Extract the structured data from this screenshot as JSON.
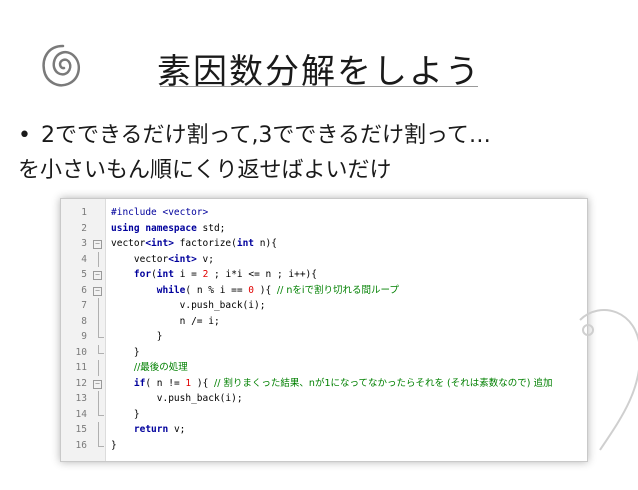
{
  "slide": {
    "title": "素因数分解をしよう",
    "bullet_line1": "2でできるだけ割って,3でできるだけ割って…",
    "bullet_line2": "を小さいもん順にくり返せばよいだけ",
    "bullet_symbol": "•"
  },
  "code": {
    "lines": [
      {
        "n": "1",
        "tokens": [
          {
            "t": "#include ",
            "c": "pp"
          },
          {
            "t": "<vector>",
            "c": "pp"
          }
        ]
      },
      {
        "n": "2",
        "tokens": [
          {
            "t": "using namespace ",
            "c": "kw"
          },
          {
            "t": "std;",
            "c": ""
          }
        ]
      },
      {
        "n": "3",
        "tokens": [
          {
            "t": "vector",
            "c": ""
          },
          {
            "t": "<int>",
            "c": "kw"
          },
          {
            "t": " factorize(",
            "c": ""
          },
          {
            "t": "int",
            "c": "kw"
          },
          {
            "t": " n){",
            "c": ""
          }
        ]
      },
      {
        "n": "4",
        "tokens": [
          {
            "t": "    vector",
            "c": ""
          },
          {
            "t": "<int>",
            "c": "kw"
          },
          {
            "t": " v;",
            "c": ""
          }
        ]
      },
      {
        "n": "5",
        "tokens": [
          {
            "t": "    ",
            "c": ""
          },
          {
            "t": "for",
            "c": "kw"
          },
          {
            "t": "(",
            "c": ""
          },
          {
            "t": "int",
            "c": "kw"
          },
          {
            "t": " i = ",
            "c": ""
          },
          {
            "t": "2",
            "c": "num"
          },
          {
            "t": " ; i*i <= n ; i++){",
            "c": ""
          }
        ]
      },
      {
        "n": "6",
        "tokens": [
          {
            "t": "        ",
            "c": ""
          },
          {
            "t": "while",
            "c": "kw"
          },
          {
            "t": "( n % i == ",
            "c": ""
          },
          {
            "t": "0",
            "c": "num"
          },
          {
            "t": " ){ ",
            "c": ""
          },
          {
            "t": "// nをiで割り切れる間ループ",
            "c": "cm"
          }
        ]
      },
      {
        "n": "7",
        "tokens": [
          {
            "t": "            v.push_back(i);",
            "c": ""
          }
        ]
      },
      {
        "n": "8",
        "tokens": [
          {
            "t": "            n /= i;",
            "c": ""
          }
        ]
      },
      {
        "n": "9",
        "tokens": [
          {
            "t": "        }",
            "c": ""
          }
        ]
      },
      {
        "n": "10",
        "tokens": [
          {
            "t": "    }",
            "c": ""
          }
        ]
      },
      {
        "n": "11",
        "tokens": [
          {
            "t": "    ",
            "c": ""
          },
          {
            "t": "//最後の処理",
            "c": "cm"
          }
        ]
      },
      {
        "n": "12",
        "tokens": [
          {
            "t": "    ",
            "c": ""
          },
          {
            "t": "if",
            "c": "kw"
          },
          {
            "t": "( n != ",
            "c": ""
          },
          {
            "t": "1",
            "c": "num"
          },
          {
            "t": " ){ ",
            "c": ""
          },
          {
            "t": "// 割りまくった結果、nが1になってなかったらそれを (それは素数なので) 追加",
            "c": "cm"
          }
        ]
      },
      {
        "n": "13",
        "tokens": [
          {
            "t": "        v.push_back(i);",
            "c": ""
          }
        ]
      },
      {
        "n": "14",
        "tokens": [
          {
            "t": "    }",
            "c": ""
          }
        ]
      },
      {
        "n": "15",
        "tokens": [
          {
            "t": "    ",
            "c": ""
          },
          {
            "t": "return",
            "c": "kw"
          },
          {
            "t": " v;",
            "c": ""
          }
        ]
      },
      {
        "n": "16",
        "tokens": [
          {
            "t": "}",
            "c": ""
          }
        ]
      }
    ],
    "folds": [
      "",
      "",
      "box",
      "bar",
      "box",
      "box",
      "bar",
      "bar",
      "end",
      "end",
      "bar",
      "box",
      "bar",
      "end",
      "bar",
      "end"
    ]
  },
  "colors": {
    "keyword": "#00009c",
    "number": "#e00000",
    "comment": "#008000"
  }
}
